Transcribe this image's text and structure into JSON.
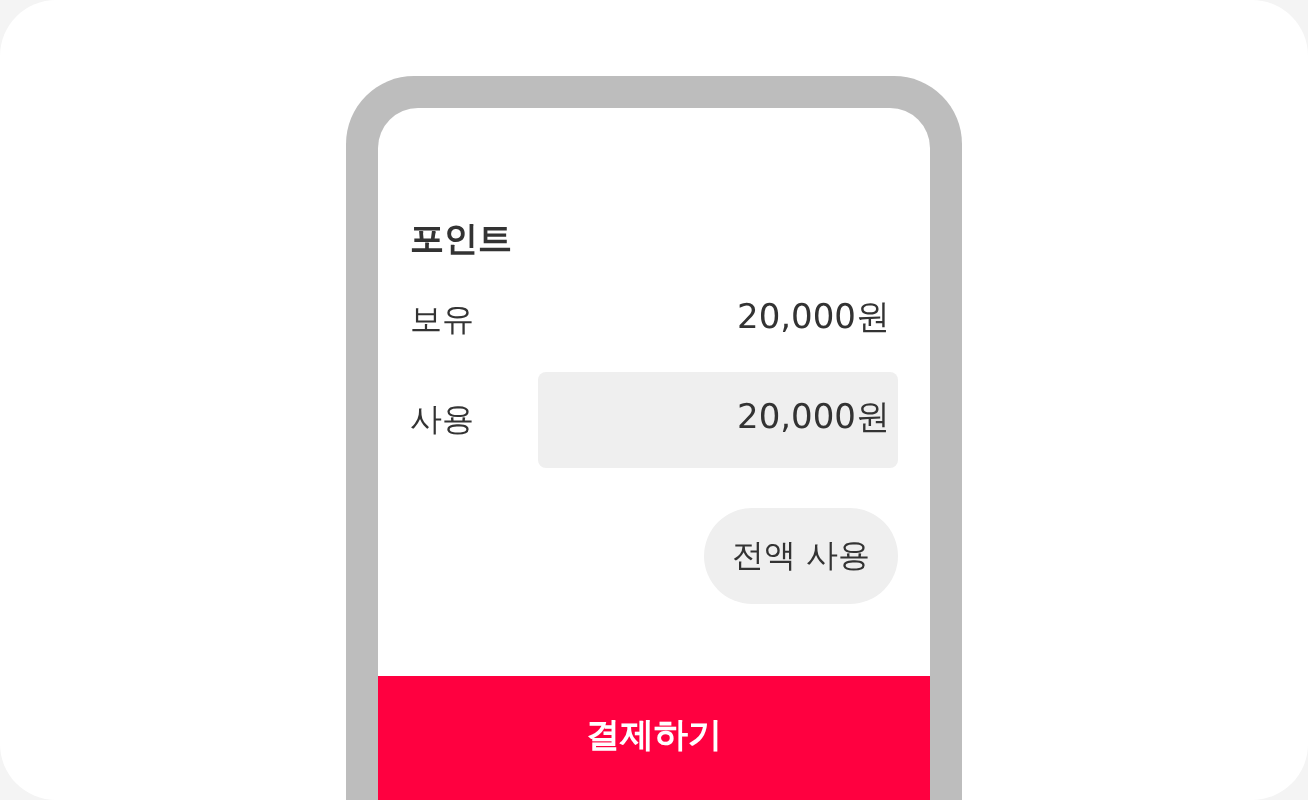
{
  "section_title": "포인트",
  "balance": {
    "label": "보유",
    "value": "20,000원"
  },
  "use": {
    "label": "사용",
    "value": "20,000원"
  },
  "use_all_button": "전액 사용",
  "pay_button": "결제하기"
}
